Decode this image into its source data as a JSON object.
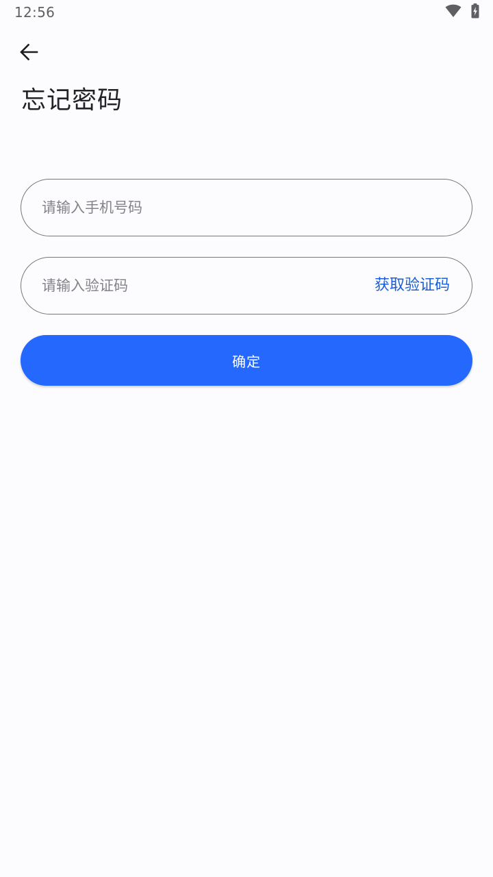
{
  "status_bar": {
    "time": "12:56",
    "icons": [
      "wifi-icon",
      "battery-charging-icon"
    ]
  },
  "header": {
    "back_icon": "arrow-left-icon",
    "title": "忘记密码"
  },
  "form": {
    "phone": {
      "value": "",
      "placeholder": "请输入手机号码"
    },
    "code": {
      "value": "",
      "placeholder": "请输入验证码",
      "get_code_label": "获取验证码"
    },
    "confirm_label": "确定"
  },
  "colors": {
    "background": "#fcfbfe",
    "primary": "#2468fe",
    "link": "#1a5fd6",
    "field_border": "#77777b",
    "placeholder": "#83838a",
    "title": "#222326"
  }
}
